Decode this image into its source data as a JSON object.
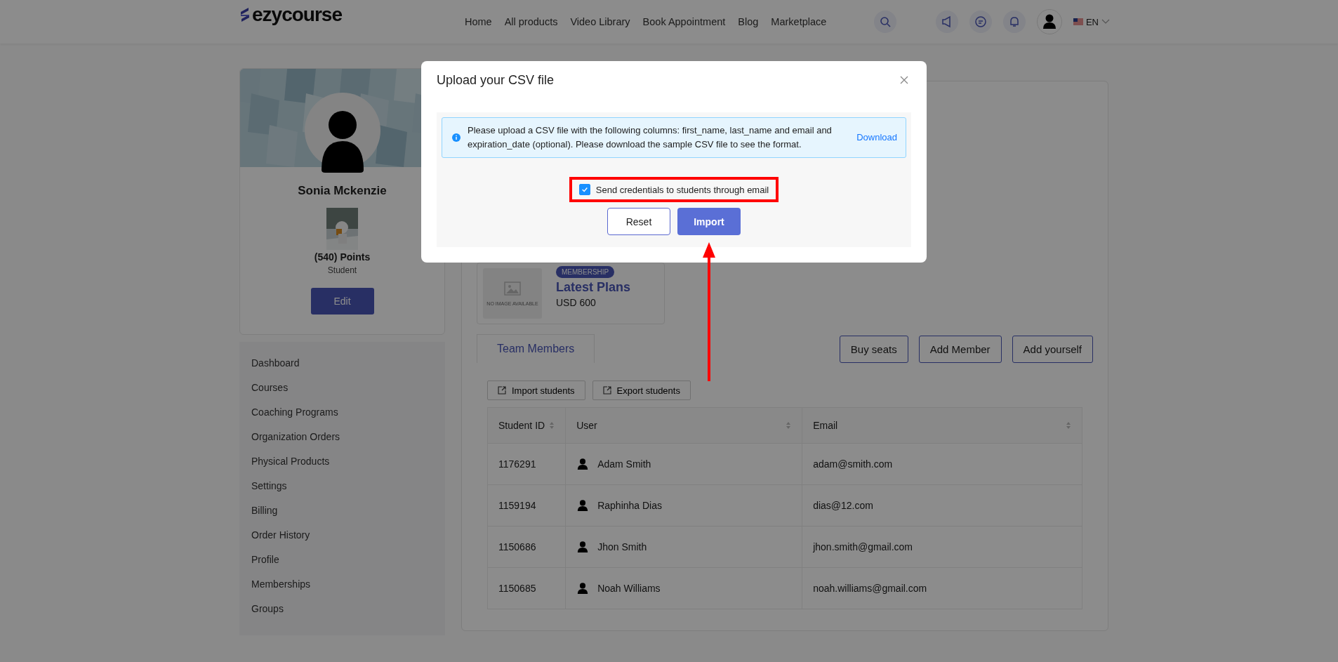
{
  "header": {
    "logo": "ezycourse",
    "nav": [
      "Home",
      "All products",
      "Video Library",
      "Book Appointment",
      "Blog",
      "Marketplace"
    ],
    "language": "EN"
  },
  "profile": {
    "name": "Sonia Mckenzie",
    "points": "(540) Points",
    "role": "Student",
    "edit": "Edit"
  },
  "sidebar": {
    "items": [
      "Dashboard",
      "Courses",
      "Coaching Programs",
      "Organization Orders",
      "Physical Products",
      "Settings",
      "Billing",
      "Order History",
      "Profile",
      "Memberships",
      "Groups"
    ]
  },
  "membership": {
    "image_text": "NO IMAGE AVAILABLE",
    "badge": "MEMBERSHIP",
    "title": "Latest Plans",
    "price": "USD 600"
  },
  "tabs": [
    {
      "label": "Team Members",
      "selected": true
    }
  ],
  "actions": [
    "Buy seats",
    "Add Member",
    "Add yourself"
  ],
  "toolbar": [
    "Import students",
    "Export students"
  ],
  "table": {
    "columns": [
      "Student ID",
      "User",
      "Email"
    ],
    "rows": [
      [
        "1176291",
        "Adam Smith",
        "adam@smith.com"
      ],
      [
        "1159194",
        "Raphinha Dias",
        "dias@12.com"
      ],
      [
        "1150686",
        "Jhon Smith",
        "jhon.smith@gmail.com"
      ],
      [
        "1150685",
        "Noah Williams",
        "noah.williams@gmail.com"
      ]
    ]
  },
  "modal": {
    "title": "Upload your CSV file",
    "info": "Please upload a CSV file with the following columns: first_name, last_name and email and expiration_date (optional). Please download the sample CSV file to see the format.",
    "download": "Download",
    "checkbox": {
      "label": "Send credentials to students through email",
      "checked": true
    },
    "buttons": [
      {
        "label": "Reset",
        "kind": "secondary"
      },
      {
        "label": "Import",
        "kind": "primary"
      }
    ]
  }
}
